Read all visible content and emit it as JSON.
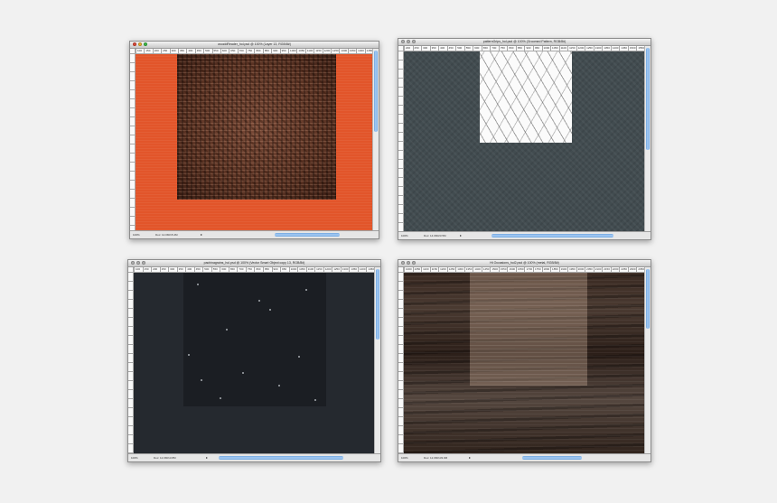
{
  "windows": [
    {
      "title": "wooddReader_hol.psd @ 100% (Layer 13, RGB/8#)",
      "ruler": [
        "100",
        "150",
        "200",
        "250",
        "300",
        "350",
        "400",
        "450",
        "500",
        "550",
        "600",
        "650",
        "700",
        "750",
        "800",
        "850",
        "900",
        "950",
        "1000",
        "1050",
        "1100",
        "1150",
        "1200",
        "1250",
        "1300",
        "1350",
        "1400",
        "1450"
      ],
      "zoom": "100%",
      "doc": "Doc: 12.0M/15.4M",
      "colors": {
        "background": "#e2552a",
        "texture": "#5c3424"
      }
    },
    {
      "title": "patternGrips_hol.psd @ 100% (Groomed Pattern, RGB/8#)",
      "ruler": [
        "200",
        "250",
        "300",
        "350",
        "400",
        "450",
        "500",
        "550",
        "600",
        "650",
        "700",
        "750",
        "800",
        "850",
        "900",
        "950",
        "1000",
        "1050",
        "1100",
        "1150",
        "1200",
        "1250",
        "1300",
        "1350",
        "1400",
        "1450",
        "1500",
        "1550"
      ],
      "zoom": "100%",
      "doc": "Doc: 14.0M/23.5M",
      "colors": {
        "background": "#424c50",
        "pattern": "#fbfbfb"
      }
    },
    {
      "title": "pachinagrains_hol.psd @ 100% (Vector Smart Object copy 13, RGB/8#)",
      "ruler": [
        "100",
        "150",
        "200",
        "250",
        "300",
        "350",
        "400",
        "450",
        "500",
        "550",
        "600",
        "650",
        "700",
        "750",
        "800",
        "850",
        "900",
        "950",
        "1000",
        "1050",
        "1100",
        "1150",
        "1200",
        "1250",
        "1300",
        "1350",
        "1400",
        "1450"
      ],
      "zoom": "100%",
      "doc": "Doc: 12.0M/13.8M",
      "colors": {
        "background": "#25292f",
        "inner": "#1b1e23"
      }
    },
    {
      "title": "Ht Occasions_hol2.psd @ 100% (metal, RGB/8#)",
      "ruler": [
        "1000",
        "1050",
        "1100",
        "1150",
        "1200",
        "1250",
        "1300",
        "1350",
        "1400",
        "1450",
        "1500",
        "1550",
        "1600",
        "1650",
        "1700",
        "1750",
        "1800",
        "1850",
        "1900",
        "1950",
        "2000",
        "2050",
        "2100",
        "2150",
        "2200",
        "2250",
        "2300",
        "2350"
      ],
      "zoom": "100%",
      "doc": "Doc: 12.0M/133.0M",
      "colors": {
        "background": "#3a2a22",
        "overlay": "#bea08c"
      }
    }
  ]
}
